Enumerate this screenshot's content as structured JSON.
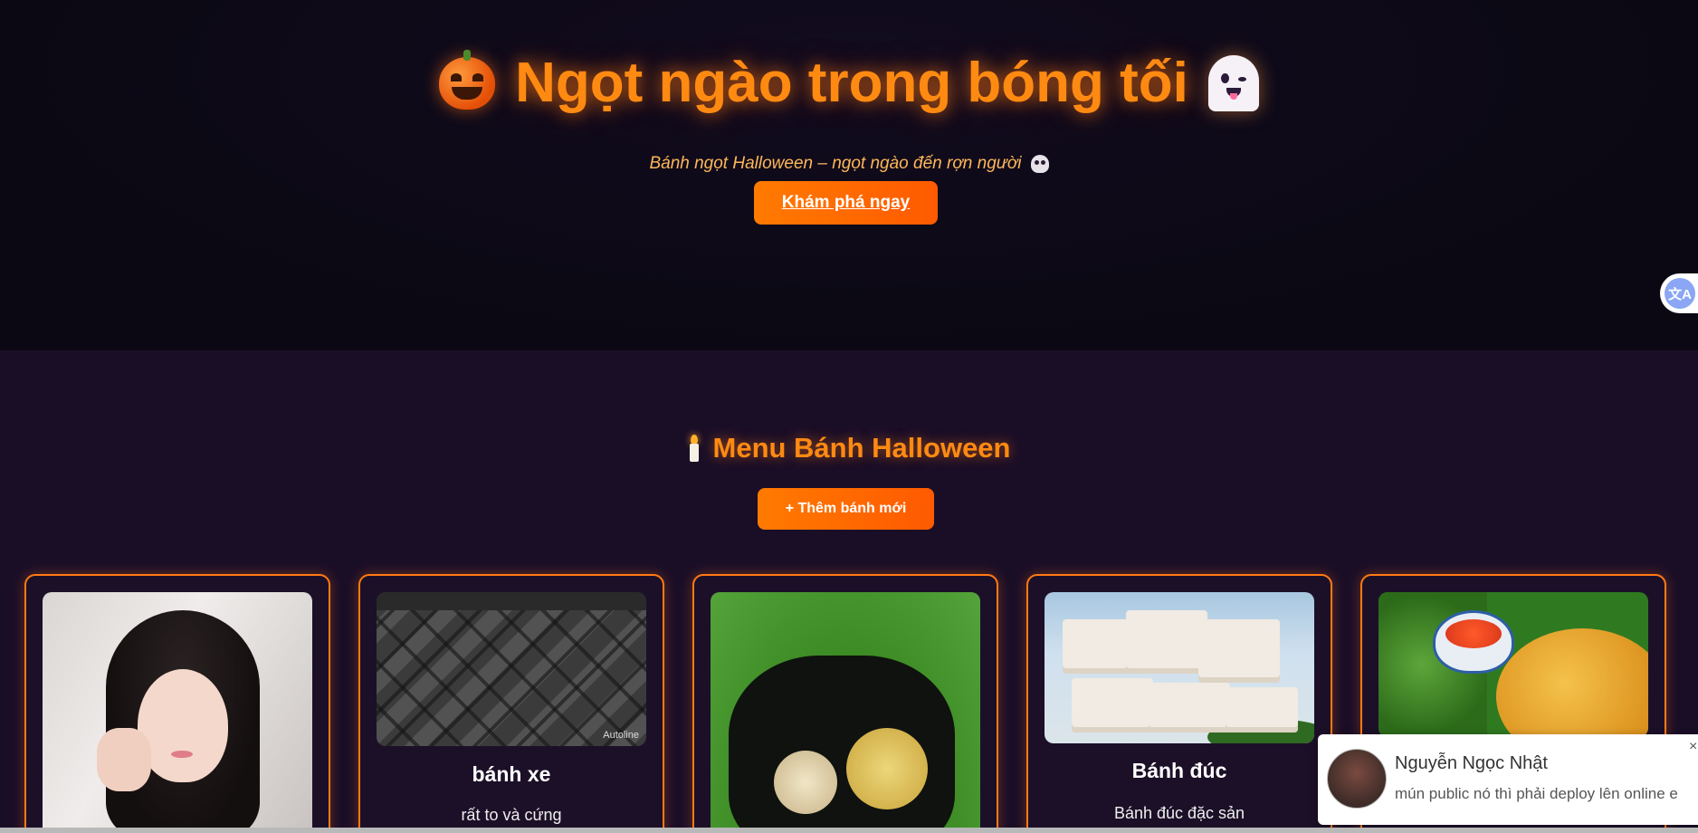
{
  "hero": {
    "title": "Ngọt ngào trong bóng tối",
    "subtitle": "Bánh ngọt Halloween – ngọt ngào đến rợn người",
    "cta_label": "Khám phá ngay"
  },
  "translate": {
    "label": "文A"
  },
  "menu": {
    "title": "Menu Bánh Halloween",
    "add_button_label": "+ Thêm bánh mới",
    "cards": [
      {
        "name": "",
        "description": ""
      },
      {
        "name": "bánh xe",
        "description": "rất to và cứng",
        "image_watermark": "Autoline"
      },
      {
        "name": "",
        "description": ""
      },
      {
        "name": "Bánh đúc",
        "description": "Bánh đúc đặc sản"
      },
      {
        "name": "",
        "description": ""
      }
    ]
  },
  "notification": {
    "sender": "Nguyễn Ngọc Nhật",
    "message": "mún public nó thì phải deploy lên online e",
    "close_label": "×"
  },
  "colors": {
    "accent": "#ff7a00",
    "title_orange": "#ff8a12",
    "hero_bg": "#0b0813",
    "menu_bg": "#1a0e27"
  }
}
